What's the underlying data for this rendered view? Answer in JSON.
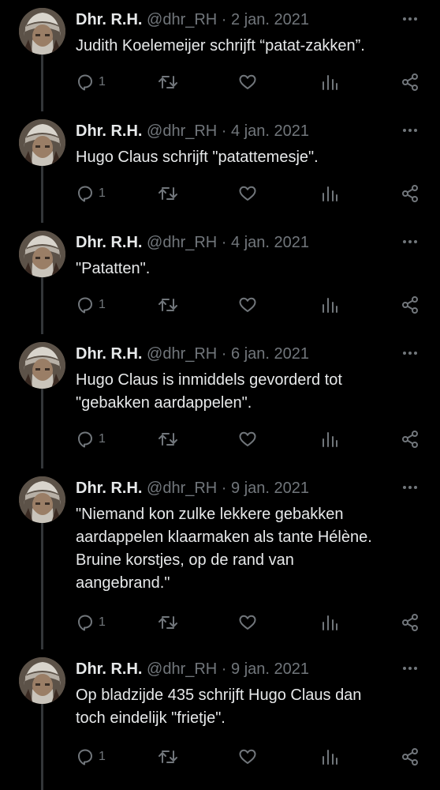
{
  "tweets": [
    {
      "name": "Dhr. R.H.",
      "handle": "@dhr_RH",
      "dot": "·",
      "date": "2 jan. 2021",
      "lines": [
        "Judith Koelemeijer schrijft “patat-zakken”."
      ],
      "reply_count": "1"
    },
    {
      "name": "Dhr. R.H.",
      "handle": "@dhr_RH",
      "dot": "·",
      "date": "4 jan. 2021",
      "lines": [
        "Hugo Claus schrijft \"patattemesje\"."
      ],
      "reply_count": "1"
    },
    {
      "name": "Dhr. R.H.",
      "handle": "@dhr_RH",
      "dot": "·",
      "date": "4 jan. 2021",
      "lines": [
        "\"Patatten\"."
      ],
      "reply_count": "1"
    },
    {
      "name": "Dhr. R.H.",
      "handle": "@dhr_RH",
      "dot": "·",
      "date": "6 jan. 2021",
      "lines": [
        "Hugo Claus is inmiddels gevorderd tot",
        "\"gebakken aardappelen\"."
      ],
      "reply_count": "1"
    },
    {
      "name": "Dhr. R.H.",
      "handle": "@dhr_RH",
      "dot": "·",
      "date": "9 jan. 2021",
      "lines": [
        "\"Niemand kon zulke lekkere gebakken",
        "aardappelen klaarmaken als tante Hélène.",
        "Bruine korstjes, op de rand van",
        "aangebrand.\""
      ],
      "reply_count": "1"
    },
    {
      "name": "Dhr. R.H.",
      "handle": "@dhr_RH",
      "dot": "·",
      "date": "9 jan. 2021",
      "lines": [
        "Op bladzijde 435 schrijft Hugo Claus dan",
        "toch eindelijk \"frietje\"."
      ],
      "reply_count": "1"
    }
  ],
  "icons": {
    "more": "more-horizontal-icon",
    "reply": "reply-bubble-icon",
    "retweet": "retweet-icon",
    "like": "heart-icon",
    "views": "views-bar-chart-icon",
    "share": "share-icon"
  },
  "colors": {
    "background": "#000000",
    "text": "#e7e9ea",
    "secondary": "#71767b",
    "thread_line": "#333639"
  }
}
